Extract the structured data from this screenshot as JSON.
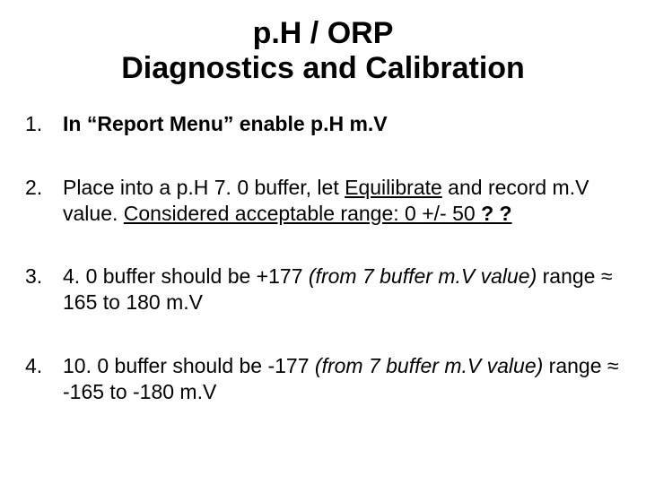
{
  "title_line1": "p.H / ORP",
  "title_line2": "Diagnostics and Calibration",
  "steps": {
    "n1": "1.",
    "s1_bold": "In “Report Menu” enable p.H m.V",
    "n2": "2.",
    "s2_a": "Place into a p.H 7. 0 buffer, let ",
    "s2_equil": "Equilibrate",
    "s2_b": " and record m.V value. ",
    "s2_range": "Considered acceptable range: 0 +/- 50 ",
    "s2_qq": "? ?",
    "n3": "3.",
    "s3_a": "4. 0 buffer should be +177 ",
    "s3_paren": "(from 7 buffer m.V value)",
    "s3_b": " range ",
    "s3_approx": "≈",
    "s3_c": " 165 to 180 m.V",
    "n4": "4.",
    "s4_a": "10. 0 buffer should be -177 ",
    "s4_paren": "(from 7 buffer m.V value)",
    "s4_b": " range ",
    "s4_approx": "≈",
    "s4_c": " -165 to -180 m.V"
  }
}
